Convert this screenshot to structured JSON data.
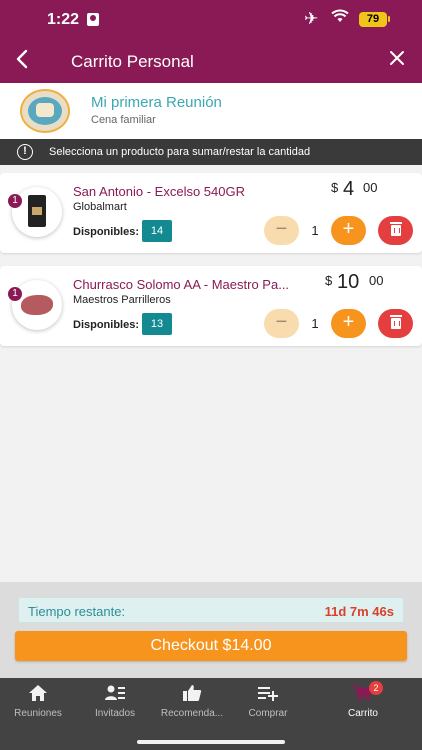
{
  "status_bar": {
    "time": "1:22",
    "battery": "79"
  },
  "nav": {
    "title": "Carrito Personal"
  },
  "meeting": {
    "name": "Mi primera Reunión",
    "subtitle": "Cena familiar"
  },
  "info": {
    "text": "Selecciona un producto para sumar/restar la cantidad"
  },
  "products": [
    {
      "badge": "1",
      "name": "San Antonio - Excelso 540GR",
      "store": "Globalmart",
      "available_label": "Disponibles:",
      "available": "14",
      "currency": "$",
      "price_int": "4",
      "price_cents": "00",
      "quantity": "1",
      "minus_label": "−",
      "plus_label": "+"
    },
    {
      "badge": "1",
      "name": "Churrasco Solomo AA - Maestro Pa...",
      "store": "Maestros Parrilleros",
      "available_label": "Disponibles:",
      "available": "13",
      "currency": "$",
      "price_int": "10",
      "price_cents": "00",
      "quantity": "1",
      "minus_label": "−",
      "plus_label": "+"
    }
  ],
  "timer": {
    "label": "Tiempo restante:",
    "value": "11d 7m 46s"
  },
  "checkout": {
    "label": "Checkout $14.00"
  },
  "tabs": [
    {
      "label": "Reuniones",
      "icon": "home-icon"
    },
    {
      "label": "Invitados",
      "icon": "guests-icon"
    },
    {
      "label": "Recomenda...",
      "icon": "thumbs-up-icon"
    },
    {
      "label": "Comprar",
      "icon": "playlist-add-icon"
    },
    {
      "label": "Carrito",
      "icon": "cart-icon",
      "badge": "2"
    }
  ],
  "colors": {
    "brand": "#8a1a55",
    "teal": "#138a92",
    "orange": "#f7941d",
    "red": "#e53e3e",
    "tabbar": "#434343"
  }
}
